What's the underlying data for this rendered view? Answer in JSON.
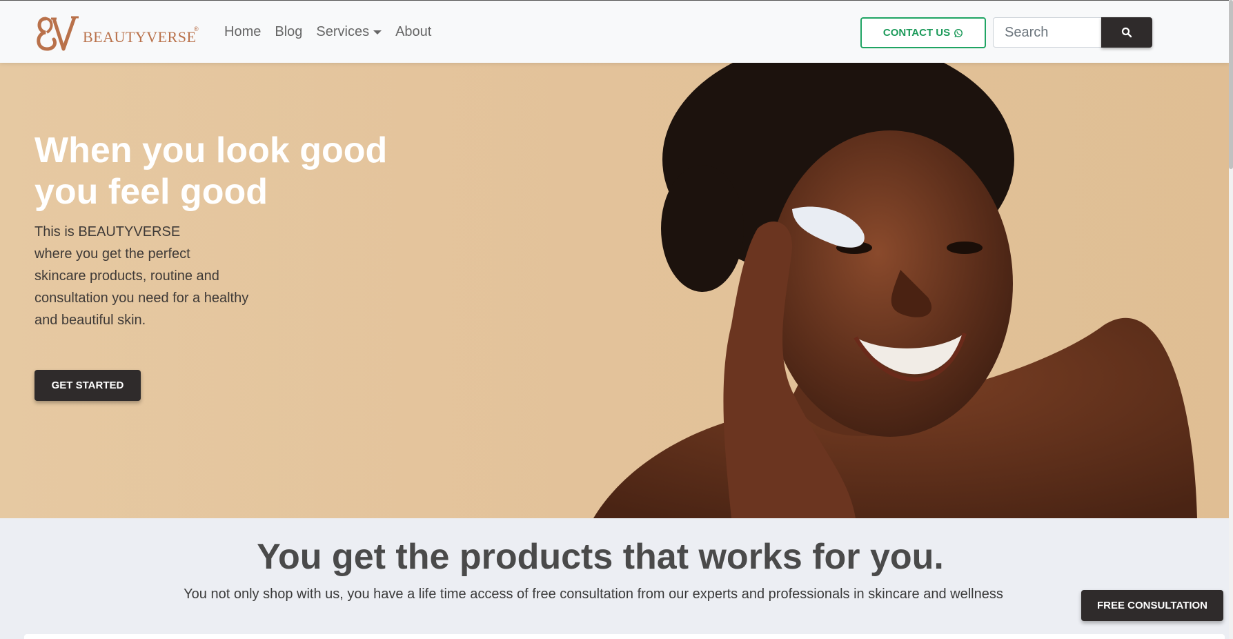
{
  "brand": {
    "name": "BEAUTYVERSE",
    "registered": "®",
    "monogram": "BV",
    "color": "#b9714a"
  },
  "nav": {
    "items": [
      {
        "label": "Home"
      },
      {
        "label": "Blog"
      },
      {
        "label": "Services",
        "has_dropdown": true
      },
      {
        "label": "About"
      }
    ]
  },
  "header": {
    "contact_label": "CONTACT US",
    "contact_icon": "whatsapp-icon",
    "contact_color": "#1fa463",
    "search_placeholder": "Search",
    "search_icon": "search-icon"
  },
  "hero": {
    "title_lines": [
      "When you look good",
      "you feel good"
    ],
    "body_lines": [
      "This is BEAUTYVERSE",
      "where you get the perfect",
      "skincare products, routine and",
      "consultation you need for a healthy",
      "and beautiful skin."
    ],
    "cta_label": "GET STARTED"
  },
  "section": {
    "title": "You get the products that works for you.",
    "subtitle": "You not only shop with us, you have a life time access of free consultation from our experts and professionals in skincare and wellness"
  },
  "floating_button": {
    "label": "FREE CONSULTATION"
  },
  "colors": {
    "dark_button": "#2f2b2b",
    "hero_bg": "#e3c29a",
    "section_bg": "#eceef3"
  }
}
